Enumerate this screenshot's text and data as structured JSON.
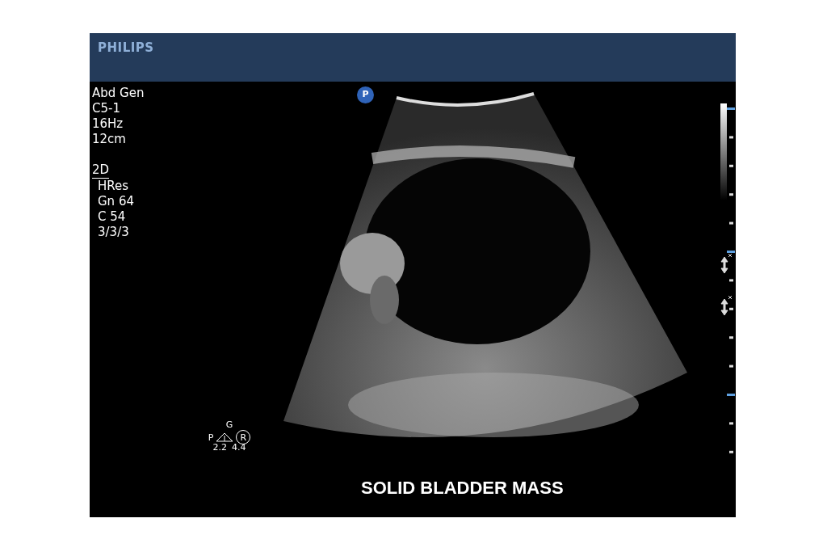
{
  "header": {
    "brand": "PHILIPS"
  },
  "preset": [
    "Abd Gen",
    "C5-1",
    "16Hz",
    "12cm"
  ],
  "mode": {
    "title": "2D",
    "settings": [
      "HRes",
      "Gn 64",
      "C 54",
      "3/3/3"
    ]
  },
  "badge": "P",
  "orientation_marker": {
    "left": "P",
    "top": "G",
    "right": "R",
    "values": [
      "2.2",
      "4.4"
    ]
  },
  "caption": "SOLID BLADDER MASS"
}
